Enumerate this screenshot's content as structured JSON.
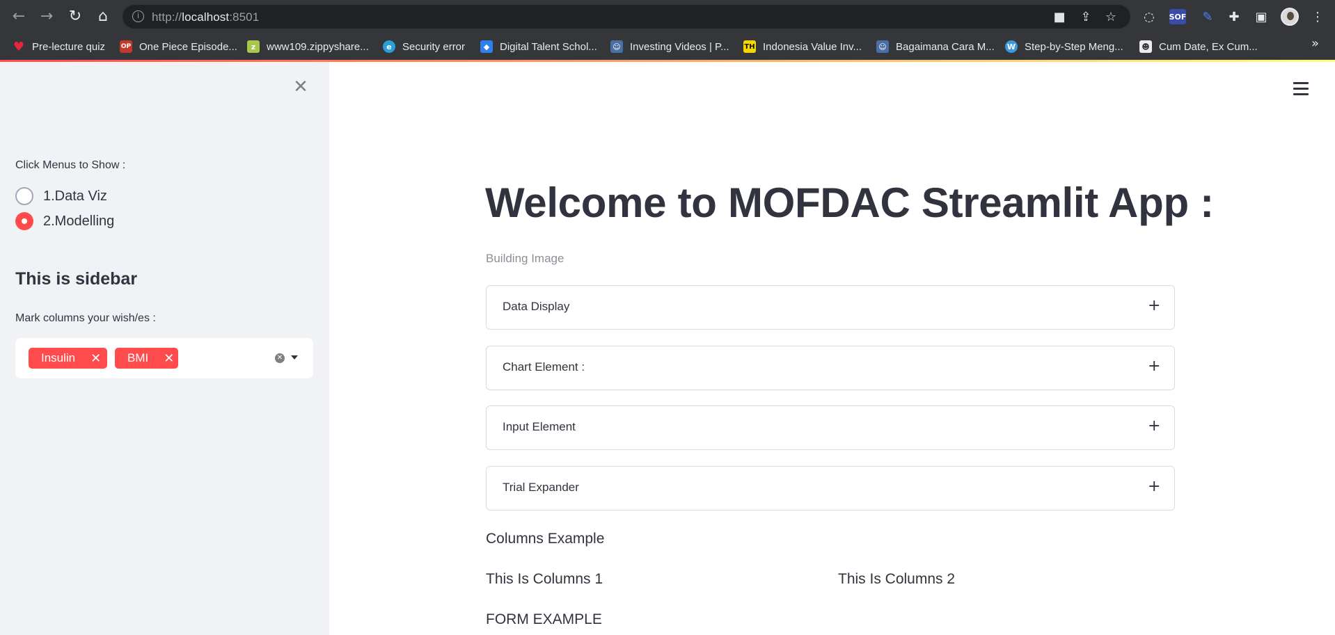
{
  "browser": {
    "url_host": "http://",
    "url_main": "localhost",
    "url_port": ":8501",
    "bookmarks": [
      {
        "label": "Pre-lecture quiz",
        "icon": "heart-icon",
        "color": "#e8243e"
      },
      {
        "label": "One Piece Episode...",
        "icon": "onepiece-icon",
        "color": "#c0392b"
      },
      {
        "label": "www109.zippyshare...",
        "icon": "zippyshare-icon",
        "color": "#a6c84a"
      },
      {
        "label": "Security error",
        "icon": "security-icon",
        "color": "#2a9fd6"
      },
      {
        "label": "Digital Talent Schol...",
        "icon": "dts-icon",
        "color": "#2f80ed"
      },
      {
        "label": "Investing Videos | P...",
        "icon": "investing-icon",
        "color": "#4a6fa5"
      },
      {
        "label": "Indonesia Value Inv...",
        "icon": "th-icon",
        "color": "#f5d800"
      },
      {
        "label": "Bagaimana Cara M...",
        "icon": "person-icon",
        "color": "#4a6fa5"
      },
      {
        "label": "Step-by-Step Meng...",
        "icon": "wordpress-icon",
        "color": "#3b9ad9"
      },
      {
        "label": "Cum Date, Ex Cum...",
        "icon": "person-icon",
        "color": "#777777"
      }
    ],
    "sof_label": "SOF",
    "bookmark_th_label": "TH"
  },
  "sidebar": {
    "menu_label": "Click Menus to Show :",
    "radio_options": [
      {
        "label": "1.Data Viz",
        "checked": false
      },
      {
        "label": "2.Modelling",
        "checked": true
      }
    ],
    "title": "This is sidebar",
    "columns_label": "Mark columns your wish/es :",
    "chips": [
      "Insulin",
      "BMI"
    ]
  },
  "main": {
    "title": "Welcome to MOFDAC Streamlit App :",
    "caption": "Building Image",
    "expanders": [
      "Data Display",
      "Chart Element :",
      "Input Element",
      "Trial Expander"
    ],
    "columns_heading": "Columns Example",
    "column1": "This Is Columns 1",
    "column2": "This Is Columns 2",
    "form_heading": "FORM EXAMPLE"
  },
  "colors": {
    "accent": "#ff4b4b",
    "sidebar_bg": "#f0f2f6",
    "text": "#31333f",
    "chrome_bg": "#35363a"
  }
}
